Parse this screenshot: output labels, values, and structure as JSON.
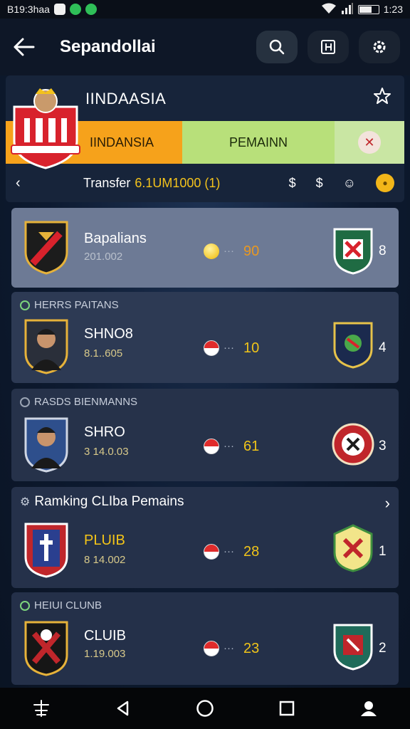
{
  "status_bar": {
    "left_text": "B19:3haa",
    "time": "1:23"
  },
  "app_bar": {
    "title": "Sepandollai"
  },
  "header": {
    "team_name": "IINDAASIA",
    "tab_a": "IINDANSIA",
    "tab_b": "PEMAINN",
    "transfer_label": "Transfer",
    "transfer_value": "6.1UM1000 (1)"
  },
  "cards": [
    {
      "section": "",
      "name": "Bapalians",
      "sub": "201.002",
      "score": "90",
      "rank": "8",
      "mid_icon": "coin-icon",
      "name_style": "white"
    },
    {
      "section": "HERRS PAITANS",
      "name": "SHNO8",
      "sub": "8.1..605",
      "score": "10",
      "rank": "4",
      "mid_icon": "flag-icon",
      "name_style": "white"
    },
    {
      "section": "RASDS BIENMANNS",
      "name": "SHRO",
      "sub": "3 14.0.03",
      "score": "61",
      "rank": "3",
      "mid_icon": "flag-icon",
      "name_style": "white"
    },
    {
      "section": "Ramking CLIba Pemains",
      "name": "PLUIB",
      "sub": "8 14.002",
      "score": "28",
      "rank": "1",
      "mid_icon": "flag-icon",
      "name_style": "gold"
    },
    {
      "section": "HEIUI CLUNB",
      "name": "CLUIB",
      "sub": "1.19.003",
      "score": "23",
      "rank": "2",
      "mid_icon": "flag-icon",
      "name_style": "white"
    }
  ],
  "colors": {
    "tab_a": "#f6a21b",
    "tab_b": "#b8e07a",
    "accent_gold": "#f3c21c"
  }
}
